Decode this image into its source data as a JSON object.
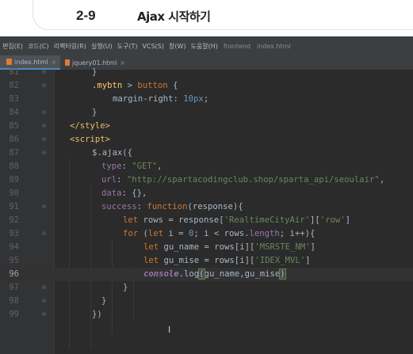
{
  "lecture": {
    "number": "2-9",
    "title": "Ajax 시작하기"
  },
  "menubar": {
    "items": [
      "편집(E)",
      "코드(C)",
      "리팩터링(R)",
      "실행(U)",
      "도구(T)",
      "VCS(S)",
      "창(W)",
      "도움말(H)"
    ],
    "project": "frontend",
    "file": "index.html"
  },
  "tabs": [
    {
      "label": "index.html",
      "active": true
    },
    {
      "label": "jquery01.html",
      "active": false
    }
  ],
  "editor": {
    "current_line": 96,
    "lines": [
      {
        "num": 81,
        "text": "}"
      },
      {
        "num": 82,
        "text": ".mybtn > button {"
      },
      {
        "num": 83,
        "text": "margin-right: 10px;"
      },
      {
        "num": 84,
        "text": "}"
      },
      {
        "num": 85,
        "text": "</style>"
      },
      {
        "num": 86,
        "text": "<script>"
      },
      {
        "num": 87,
        "text": "$.ajax({"
      },
      {
        "num": 88,
        "text": "type: \"GET\","
      },
      {
        "num": 89,
        "text": "url: \"http://spartacodingclub.shop/sparta_api/seoulair\","
      },
      {
        "num": 90,
        "text": "data: {},"
      },
      {
        "num": 91,
        "text": "success: function(response){"
      },
      {
        "num": 92,
        "text": "let rows = response['RealtimeCityAir']['row']"
      },
      {
        "num": 93,
        "text": "for (let i = 0; i < rows.length; i++){"
      },
      {
        "num": 94,
        "text": "let gu_name = rows[i]['MSRSTE_NM']"
      },
      {
        "num": 95,
        "text": "let gu_mise = rows[i]['IDEX_MVL']"
      },
      {
        "num": 96,
        "text": "console.log(gu_name,gu_mise)"
      },
      {
        "num": 97,
        "text": "}"
      },
      {
        "num": 98,
        "text": "}"
      },
      {
        "num": 99,
        "text": "})"
      }
    ]
  },
  "colors": {
    "editor_bg": "#2b2b2b",
    "keyword": "#cc7832",
    "string": "#6a8759",
    "number": "#6897bb",
    "property": "#9876aa",
    "tag": "#e8bf6a",
    "text": "#a9b7c6"
  }
}
